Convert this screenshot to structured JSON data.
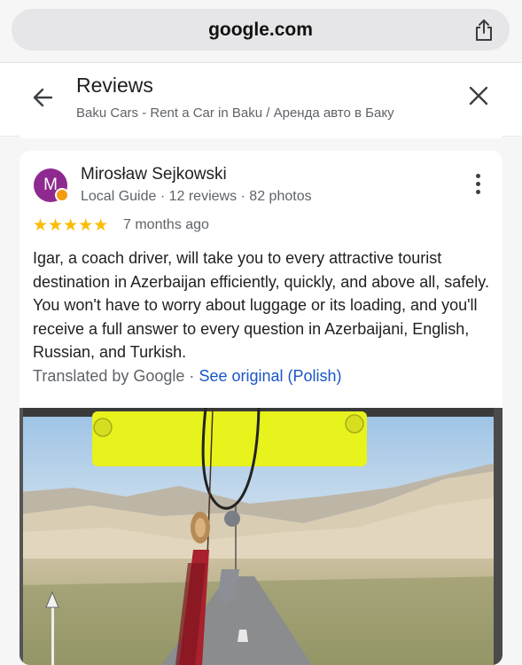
{
  "browser": {
    "url": "google.com",
    "share_icon": "share-icon"
  },
  "header": {
    "back_icon": "arrow-left-icon",
    "title": "Reviews",
    "subtitle": "Baku Cars - Rent a Car in Baku / Аренда авто в Баку",
    "close_icon": "close-icon"
  },
  "review": {
    "avatar_letter": "M",
    "avatar_color": "#8e2a8f",
    "name": "Mirosław Sejkowski",
    "meta": "Local Guide · 12 reviews · 82 photos",
    "stars": "★★★★★",
    "rating": 5,
    "date": "7 months ago",
    "text": "Igar, a coach driver, will take you to every attractive tourist destination in Azerbaijan efficiently, quickly, and above all, safely. You won't have to worry about luggage or its loading, and you'll receive a full answer to every question in Azerbaijani, English, Russian, and Turkish.",
    "translated_label": "Translated by Google · ",
    "see_original": "See original (Polish)",
    "more_icon": "more-vert-icon"
  },
  "colors": {
    "star": "#fbbc04",
    "link": "#1a56c8"
  }
}
